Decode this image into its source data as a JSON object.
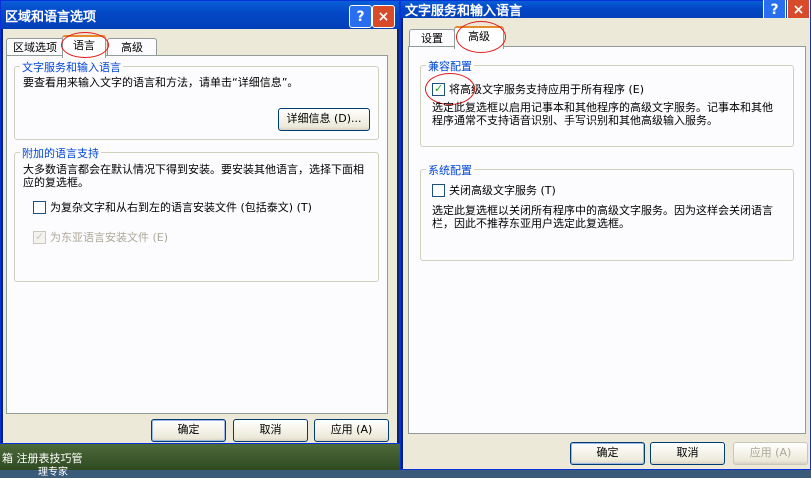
{
  "desktop": {
    "line1": "箱   注册表技巧管",
    "line2": "理专家"
  },
  "left_window": {
    "title": "区域和语言选项",
    "help": "?",
    "close": "×",
    "tabs": [
      "区域选项",
      "语言",
      "高级"
    ],
    "group1": {
      "legend": "文字服务和输入语言",
      "text": "要查看用来输入文字的语言和方法，请单击“详细信息”。",
      "details_button": "详细信息 (D)..."
    },
    "group2": {
      "legend": "附加的语言支持",
      "text": "大多数语言都会在默认情况下得到安装。要安装其他语言，选择下面相应的复选框。",
      "cb1": "为复杂文字和从右到左的语言安装文件 (包括泰文) (T)",
      "cb2": "为东亚语言安装文件 (E)"
    },
    "buttons": {
      "ok": "确定",
      "cancel": "取消",
      "apply": "应用 (A)"
    }
  },
  "right_window": {
    "title": "文字服务和输入语言",
    "help": "?",
    "close": "×",
    "tabs": [
      "设置",
      "高级"
    ],
    "group1": {
      "legend": "兼容配置",
      "cb": "将高级文字服务支持应用于所有程序 (E)",
      "text": "选定此复选框以启用记事本和其他程序的高级文字服务。记事本和其他程序通常不支持语音识别、手写识别和其他高级输入服务。"
    },
    "group2": {
      "legend": "系统配置",
      "cb": "关闭高级文字服务 (T)",
      "text": "选定此复选框以关闭所有程序中的高级文字服务。因为这样会关闭语言栏，因此不推荐东亚用户选定此复选框。"
    },
    "buttons": {
      "ok": "确定",
      "cancel": "取消",
      "apply": "应用 (A)"
    }
  }
}
